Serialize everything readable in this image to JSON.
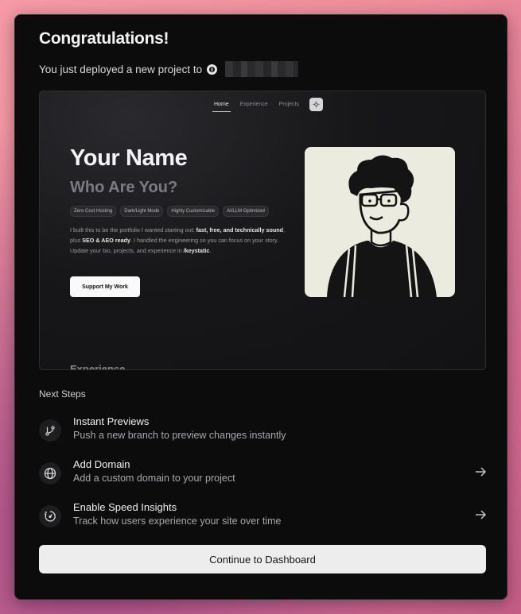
{
  "header": {
    "title": "Congratulations!",
    "subtitle": "You just deployed a new project to"
  },
  "preview": {
    "nav": [
      "Home",
      "Experience",
      "Projects"
    ],
    "name": "Your Name",
    "tagline": "Who Are You?",
    "tags": [
      "Zero Cost Hosting",
      "Dark/Light Mode",
      "Highly Customizable",
      "AI/LLM Optimized"
    ],
    "bio_parts": {
      "p1": "I built this to be the portfolio I wanted starting out: ",
      "b1": "fast, free, and technically sound",
      "p2": ", plus ",
      "b2": "SEO & AEO ready",
      "p3": ". I handled the engineering so you can focus on your story. Update your bio, projects, and experience in ",
      "b3": "/keystatic",
      "p4": "."
    },
    "support_button": "Support My Work",
    "section_peek": "Experience"
  },
  "next_steps": {
    "title": "Next Steps",
    "items": [
      {
        "title": "Instant Previews",
        "desc": "Push a new branch to preview changes instantly",
        "icon": "git-branch-icon",
        "arrow": false
      },
      {
        "title": "Add Domain",
        "desc": "Add a custom domain to your project",
        "icon": "globe-icon",
        "arrow": true
      },
      {
        "title": "Enable Speed Insights",
        "desc": "Track how users experience your site over time",
        "icon": "speed-gauge-icon",
        "arrow": true
      }
    ]
  },
  "continue_button": "Continue to Dashboard"
}
